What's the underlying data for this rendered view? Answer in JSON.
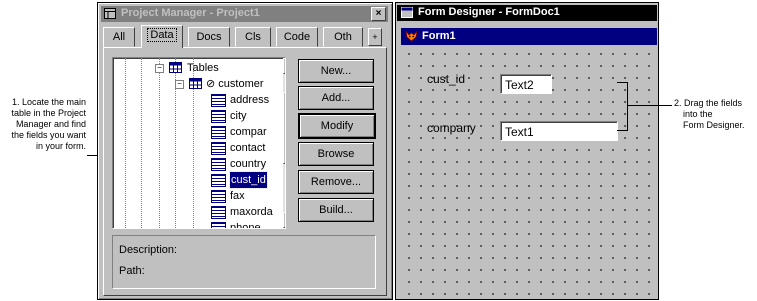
{
  "annotations": {
    "left": [
      "1. Locate the main",
      "table in the Project",
      "Manager and find",
      "the fields you want",
      "in your form."
    ],
    "right": [
      "2. Drag the fields",
      "into the",
      "Form Designer."
    ]
  },
  "project_manager": {
    "title": "Project Manager - Project1",
    "close_glyph": "×",
    "tabs": [
      "All",
      "Data",
      "Docs",
      "Cls",
      "Code",
      "Oth"
    ],
    "tab_more": "+",
    "tree": {
      "tables_label": "Tables",
      "table_label": "⊘ customer",
      "fields": [
        "address",
        "city",
        "compar",
        "contact",
        "country",
        "cust_id",
        "fax",
        "maxorda",
        "phone"
      ],
      "selected_field": "cust_id"
    },
    "buttons": [
      "New...",
      "Add...",
      "Modify",
      "Browse",
      "Remove...",
      "Build..."
    ],
    "description_label": "Description:",
    "path_label": "Path:"
  },
  "form_designer": {
    "title": "Form Designer - FormDoc1",
    "form_title": "Form1",
    "fields": [
      {
        "label": "cust_id",
        "textbox": "Text2"
      },
      {
        "label": "company",
        "textbox": "Text1"
      }
    ]
  },
  "icons": {
    "project-icon": "project manager window icon",
    "form-icon": "fox form icon",
    "table-icon": "table icon",
    "field-icon": "field icon"
  }
}
